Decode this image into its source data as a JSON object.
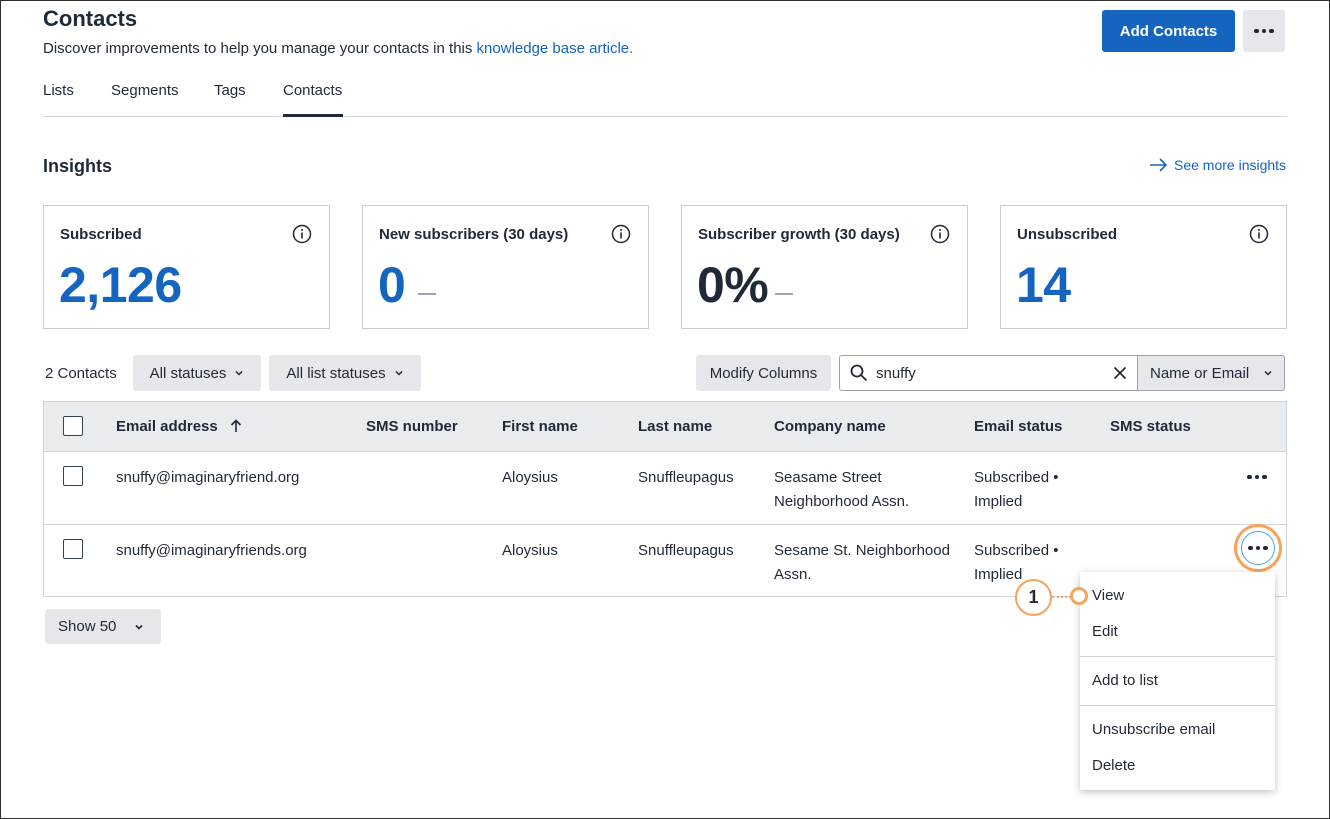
{
  "header": {
    "title": "Contacts",
    "subtitle": "Discover improvements to help you manage your contacts in this ",
    "subtitle_link": "knowledge base article.",
    "add_button": "Add Contacts"
  },
  "tabs": [
    {
      "label": "Lists",
      "active": false
    },
    {
      "label": "Segments",
      "active": false
    },
    {
      "label": "Tags",
      "active": false
    },
    {
      "label": "Contacts",
      "active": true
    }
  ],
  "insights": {
    "title": "Insights",
    "see_more": "See more insights",
    "cards": [
      {
        "label": "Subscribed",
        "value": "2,126"
      },
      {
        "label": "New subscribers (30 days)",
        "value": "0"
      },
      {
        "label": "Subscriber growth (30 days)",
        "value": "0%"
      },
      {
        "label": "Unsubscribed",
        "value": "14"
      }
    ]
  },
  "filters": {
    "count": "2 Contacts",
    "status": "All statuses",
    "list_status": "All list statuses",
    "modify_columns": "Modify Columns",
    "search_value": "snuffy",
    "search_scope": "Name or Email"
  },
  "table": {
    "columns": [
      "Email address",
      "SMS number",
      "First name",
      "Last name",
      "Company name",
      "Email status",
      "SMS status"
    ],
    "rows": [
      {
        "email": "snuffy@imaginaryfriend.org",
        "sms": "",
        "first": "Aloysius",
        "last": "Snuffleupagus",
        "company_1": "Seasame Street",
        "company_2": "Neighborhood Assn.",
        "status_1": "Subscribed •",
        "status_2": "Implied",
        "sms_status": ""
      },
      {
        "email": "snuffy@imaginaryfriends.org",
        "sms": "",
        "first": "Aloysius",
        "last": "Snuffleupagus",
        "company_1": "Sesame St. Neighborhood",
        "company_2": "Assn.",
        "status_1": "Subscribed •",
        "status_2": "Implied",
        "sms_status": ""
      }
    ]
  },
  "pagination": {
    "show": "Show 50"
  },
  "menu": {
    "items": [
      "View",
      "Edit",
      "Add to list",
      "Unsubscribe email",
      "Delete"
    ]
  },
  "callout": {
    "number": "1"
  },
  "colors": {
    "accent": "#1565c0",
    "highlight": "#f7a35c"
  }
}
